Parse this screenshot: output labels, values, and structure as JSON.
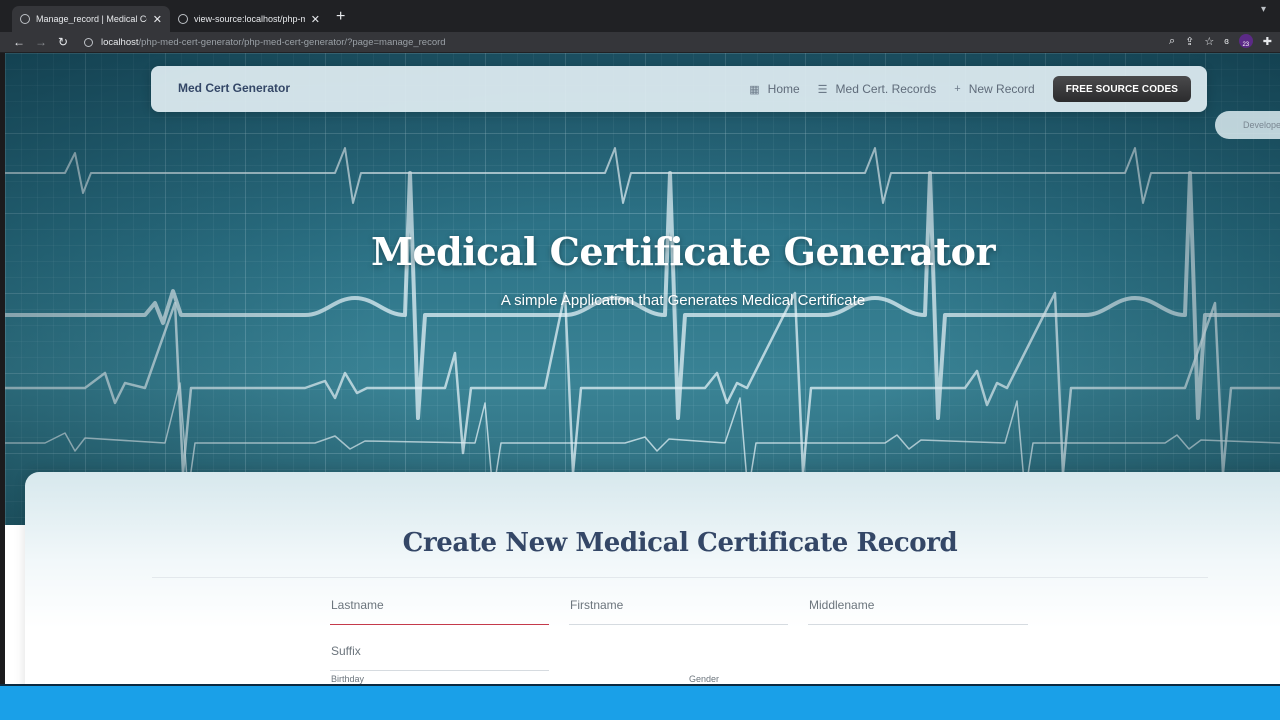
{
  "browser": {
    "tabs": [
      {
        "title": "Manage_record | Medical Certificate Generator",
        "active": true
      },
      {
        "title": "view-source:localhost/php-med-cert-generator",
        "active": false
      }
    ],
    "url_host": "localhost",
    "url_path": "/php-med-cert-generator/php-med-cert-generator/?page=manage_record",
    "extension_badge": "23"
  },
  "navbar": {
    "brand": "Med Cert Generator",
    "links": [
      {
        "label": "Home",
        "icon": "dashboard-icon"
      },
      {
        "label": "Med Cert. Records",
        "icon": "list-icon"
      },
      {
        "label": "New Record",
        "icon": "plus-icon"
      }
    ],
    "cta": "FREE SOURCE CODES",
    "dev_pill": "Developer"
  },
  "hero": {
    "title": "Medical Certificate Generator",
    "subtitle": "A simple Application that Generates Medical Certificate"
  },
  "form": {
    "title": "Create New Medical Certificate Record",
    "fields": {
      "lastname": "Lastname",
      "firstname": "Firstname",
      "middlename": "Middlename",
      "suffix": "Suffix"
    },
    "labels": {
      "birthday": "Birthday",
      "gender": "Gender"
    }
  },
  "colors": {
    "accent_text": "#344767",
    "hero_bg": "#2d7488",
    "focus_line": "#c53a4a",
    "taskbar": "#1aa0e8"
  }
}
